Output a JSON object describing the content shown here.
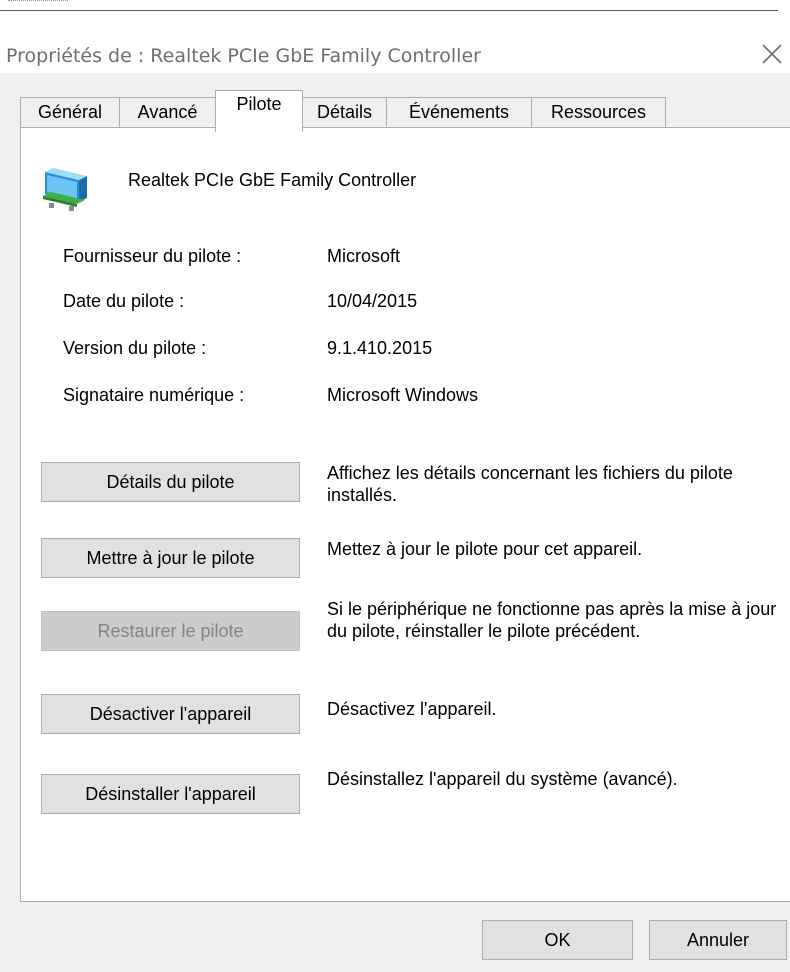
{
  "window": {
    "title": "Propriétés de : Realtek PCIe GbE Family Controller",
    "close_glyph": "✕"
  },
  "tabs": [
    {
      "label": "Général",
      "active": false
    },
    {
      "label": "Avancé",
      "active": false
    },
    {
      "label": "Pilote",
      "active": true
    },
    {
      "label": "Détails",
      "active": false
    },
    {
      "label": "Événements",
      "active": false
    },
    {
      "label": "Ressources",
      "active": false
    }
  ],
  "device": {
    "name": "Realtek PCIe GbE Family Controller",
    "icon": "network-adapter-icon"
  },
  "driver_info": [
    {
      "label": "Fournisseur du pilote :",
      "value": "Microsoft"
    },
    {
      "label": "Date du pilote :",
      "value": "10/04/2015"
    },
    {
      "label": "Version du pilote :",
      "value": "9.1.410.2015"
    },
    {
      "label": "Signataire numérique :",
      "value": "Microsoft Windows"
    }
  ],
  "actions": [
    {
      "button": "Détails du pilote",
      "description": "Affichez les détails concernant les fichiers du pilote installés.",
      "enabled": true
    },
    {
      "button": "Mettre à jour le pilote",
      "description": "Mettez à jour le pilote pour cet appareil.",
      "enabled": true
    },
    {
      "button": "Restaurer le pilote",
      "description": "Si le périphérique ne fonctionne pas après la mise à jour du pilote, réinstaller le pilote précédent.",
      "enabled": false
    },
    {
      "button": "Désactiver l'appareil",
      "description": "Désactivez l'appareil.",
      "enabled": true
    },
    {
      "button": "Désinstaller l'appareil",
      "description": "Désinstallez l'appareil du système (avancé).",
      "enabled": true
    }
  ],
  "footer": {
    "ok_label": "OK",
    "cancel_label": "Annuler"
  },
  "colors": {
    "dialog_bg": "#f0f0f0",
    "panel_bg": "#ffffff",
    "border": "#adadad",
    "button_bg": "#e1e1e1",
    "disabled_text": "#838383"
  }
}
